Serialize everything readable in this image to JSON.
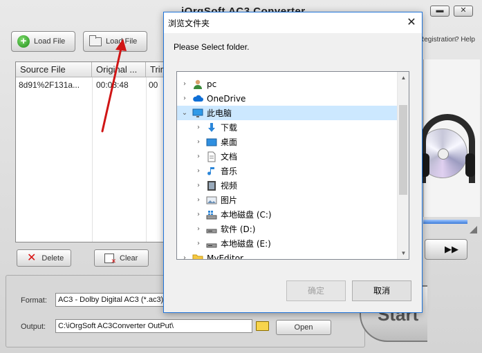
{
  "app": {
    "title": "iOrgSoft AC3 Converter",
    "toolbar": {
      "load_file_1": "Load File",
      "load_file_2": "Load File"
    },
    "registration_label": "Registration",
    "help_label": "? Help",
    "file_list": {
      "columns": [
        "Source File",
        "Original ...",
        "Trim"
      ],
      "rows": [
        {
          "source": "8d91%2F131a...",
          "original": "00:03:48",
          "trim": "00"
        }
      ]
    },
    "delete_label": "Delete",
    "clear_label": "Clear",
    "format_label": "Format:",
    "format_value": "AC3 - Dolby Digital AC3 (*.ac3)",
    "output_label": "Output:",
    "output_value": "C:\\iOrgSoft AC3Converter OutPut\\",
    "open_label": "Open",
    "start_label": "Start",
    "window_minimize_icon": "minimize-icon",
    "window_close_icon": "close-icon"
  },
  "dialog": {
    "title": "浏览文件夹",
    "close_glyph": "✕",
    "prompt": "Please Select folder.",
    "tree": [
      {
        "label": "pc",
        "icon": "user-icon",
        "indent": 0,
        "chevron": "›",
        "selected": false
      },
      {
        "label": "OneDrive",
        "icon": "cloud-icon",
        "indent": 0,
        "chevron": "›",
        "selected": false
      },
      {
        "label": "此电脑",
        "icon": "computer-icon",
        "indent": 0,
        "chevron": "⌄",
        "selected": true
      },
      {
        "label": "下载",
        "icon": "download-icon",
        "indent": 1,
        "chevron": "›",
        "selected": false
      },
      {
        "label": "桌面",
        "icon": "desktop-icon",
        "indent": 1,
        "chevron": "›",
        "selected": false
      },
      {
        "label": "文档",
        "icon": "document-icon",
        "indent": 1,
        "chevron": "›",
        "selected": false
      },
      {
        "label": "音乐",
        "icon": "music-icon",
        "indent": 1,
        "chevron": "›",
        "selected": false
      },
      {
        "label": "视频",
        "icon": "video-icon",
        "indent": 1,
        "chevron": "›",
        "selected": false
      },
      {
        "label": "图片",
        "icon": "picture-icon",
        "indent": 1,
        "chevron": "›",
        "selected": false
      },
      {
        "label": "本地磁盘 (C:)",
        "icon": "system-drive-icon",
        "indent": 1,
        "chevron": "›",
        "selected": false
      },
      {
        "label": "软件 (D:)",
        "icon": "drive-icon",
        "indent": 1,
        "chevron": "›",
        "selected": false
      },
      {
        "label": "本地磁盘 (E:)",
        "icon": "drive-icon",
        "indent": 1,
        "chevron": "›",
        "selected": false
      },
      {
        "label": "MyEditor",
        "icon": "folder-icon",
        "indent": 0,
        "chevron": "›",
        "selected": false
      }
    ],
    "ok_label": "确定",
    "cancel_label": "取消"
  }
}
